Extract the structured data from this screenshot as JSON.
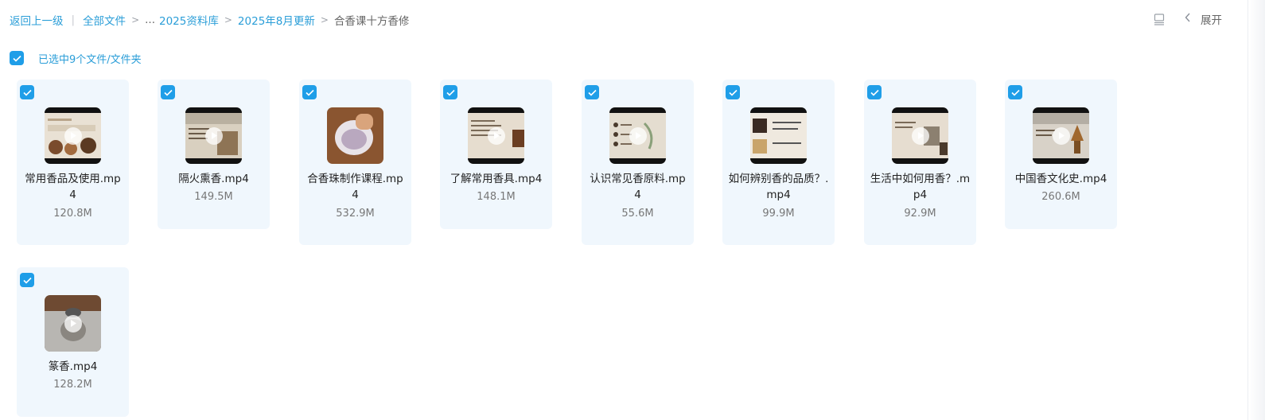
{
  "breadcrumb": {
    "back": "返回上一级",
    "divider": "|",
    "root": "全部文件",
    "sep": ">",
    "ellipsis": "...",
    "level1": "2025资料库",
    "level2": "2025年8月更新",
    "current": "合香课十方香修"
  },
  "toolbar": {
    "expand_label": "展开",
    "view_icon": "list-view-icon",
    "chevron_icon": "chevron-left-icon"
  },
  "selection": {
    "text": "已选中9个文件/文件夹",
    "checked": true
  },
  "colors": {
    "accent": "#1f9ee8",
    "link": "#2b9ed8",
    "card_bg": "#f0f7fd"
  },
  "files": [
    {
      "name": "常用香品及使用.mp4",
      "size": "120.8M",
      "type": "video",
      "checked": true
    },
    {
      "name": "隔火熏香.mp4",
      "size": "149.5M",
      "type": "video",
      "checked": true
    },
    {
      "name": "合香珠制作课程.mp4",
      "size": "532.9M",
      "type": "video",
      "checked": true
    },
    {
      "name": "了解常用香具.mp4",
      "size": "148.1M",
      "type": "video",
      "checked": true
    },
    {
      "name": "认识常见香原料.mp4",
      "size": "55.6M",
      "type": "video",
      "checked": true
    },
    {
      "name": "如何辨别香的品质？.mp4",
      "size": "99.9M",
      "type": "video",
      "checked": true
    },
    {
      "name": "生活中如何用香？.mp4",
      "size": "92.9M",
      "type": "video",
      "checked": true
    },
    {
      "name": "中国香文化史.mp4",
      "size": "260.6M",
      "type": "video",
      "checked": true
    },
    {
      "name": "篆香.mp4",
      "size": "128.2M",
      "type": "video",
      "checked": true
    }
  ]
}
